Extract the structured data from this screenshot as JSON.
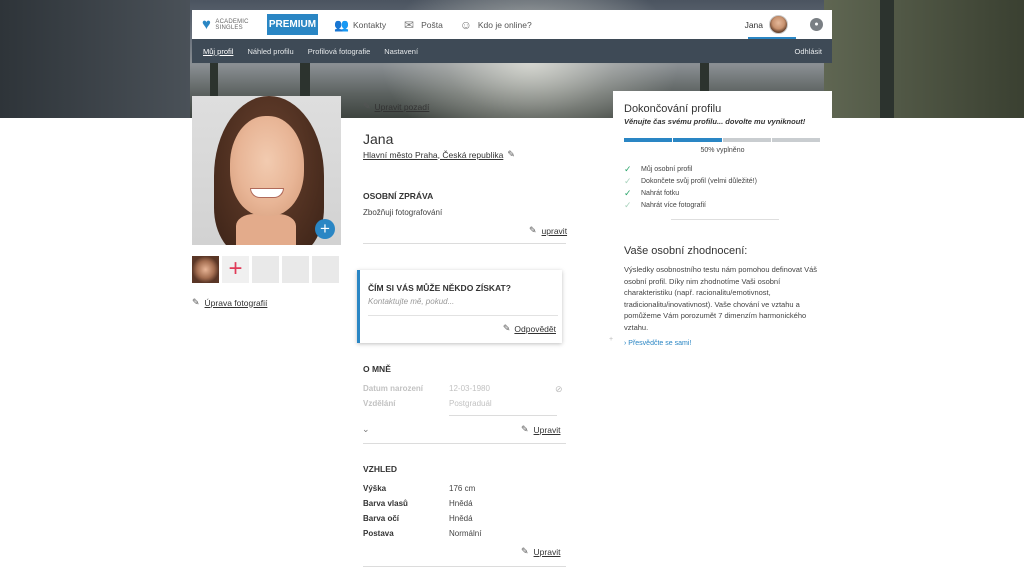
{
  "brand": {
    "logo_text": "ACADEMIC SINGLES",
    "premium": "PREMIUM",
    "accent": "#2a86c4"
  },
  "topnav": [
    {
      "label": "Kontakty",
      "icon": "contacts-icon"
    },
    {
      "label": "Pošta",
      "icon": "mail-icon"
    },
    {
      "label": "Kdo je online?",
      "icon": "online-icon"
    }
  ],
  "user": {
    "name": "Jana"
  },
  "subnav": {
    "items": [
      "Můj profil",
      "Náhled profilu",
      "Profilová fotografie",
      "Nastavení"
    ],
    "logout": "Odhlásit"
  },
  "profile": {
    "edit_background": "Upravit pozadí",
    "name": "Jana",
    "location": "Hlavní město Praha, Česká republika",
    "edit_photos": "Úprava fotografií"
  },
  "personal_message": {
    "heading": "OSOBNÍ ZPRÁVA",
    "text": "Zbožňuji fotografování",
    "edit": "upravit"
  },
  "question_card": {
    "question": "ČÍM SI VÁS MŮŽE NĚKDO ZÍSKAT?",
    "placeholder": "Kontaktujte mě, pokud...",
    "answer": "Odpovědět"
  },
  "about": {
    "heading": "O MNĚ",
    "rows": [
      {
        "label": "Datum narození",
        "value": "12-03-1980"
      },
      {
        "label": "Vzdělání",
        "value": "Postgraduál"
      }
    ],
    "edit": "Upravit"
  },
  "appearance": {
    "heading": "VZHLED",
    "rows": [
      {
        "label": "Výška",
        "value": "176 cm"
      },
      {
        "label": "Barva vlasů",
        "value": "Hnědá"
      },
      {
        "label": "Barva očí",
        "value": "Hnědá"
      },
      {
        "label": "Postava",
        "value": "Normální"
      }
    ],
    "edit": "Upravit"
  },
  "completion": {
    "title": "Dokončování profilu",
    "subtitle": "Věnujte čas svému profilu... dovolte mu vyniknout!",
    "percent_label": "50% vyplněno",
    "percent": 50,
    "items": [
      {
        "label": "Můj osobní profil",
        "done": true
      },
      {
        "label": "Dokončete svůj profil (velmi důležité!)",
        "done": false
      },
      {
        "label": "Nahrát fotku",
        "done": true
      },
      {
        "label": "Nahrát více fotografií",
        "done": false
      }
    ]
  },
  "assessment": {
    "title": "Vaše osobní zhodnocení:",
    "body": "Výsledky osobnostního testu nám pomohou definovat Váš osobní profil. Díky nim zhodnotíme Vaši osobní charakteristiku (např. racionalitu/emotivnost, tradicionalitu/inovativnost). Vaše chování ve vztahu a pomůžeme Vám porozumět 7 dimenzím harmonického vztahu.",
    "link": "Přesvědčte se sami!"
  }
}
